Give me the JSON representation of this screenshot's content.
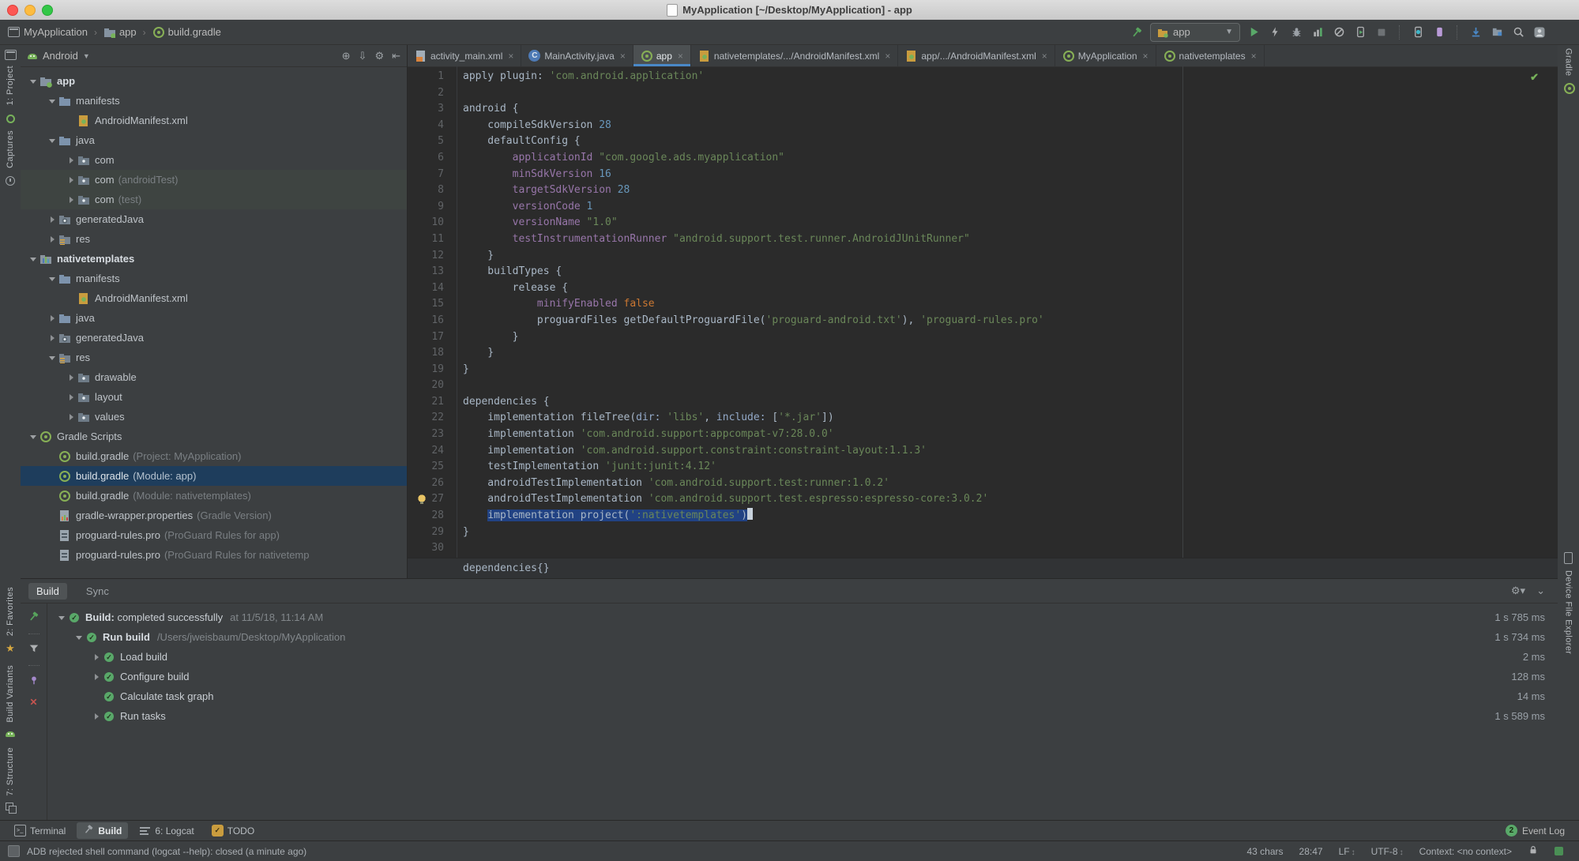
{
  "window": {
    "title": "MyApplication [~/Desktop/MyApplication] - app"
  },
  "navbar": {
    "breadcrumbs": [
      "MyApplication",
      "app",
      "build.gradle"
    ],
    "run_config": "app"
  },
  "left_strip": {
    "project": "1: Project",
    "captures": "Captures",
    "favorites": "2: Favorites",
    "build_variants": "Build Variants",
    "structure": "7: Structure"
  },
  "right_strip": {
    "gradle": "Gradle",
    "device_explorer": "Device File Explorer"
  },
  "project_panel": {
    "view_selector": "Android",
    "tree": [
      {
        "indent": 0,
        "arrow": "d",
        "icon": "folder-app",
        "label": "app",
        "bold": true
      },
      {
        "indent": 1,
        "arrow": "d",
        "icon": "folder-blue",
        "label": "manifests"
      },
      {
        "indent": 2,
        "arrow": "n",
        "icon": "manifest",
        "label": "AndroidManifest.xml"
      },
      {
        "indent": 1,
        "arrow": "d",
        "icon": "folder-blue",
        "label": "java"
      },
      {
        "indent": 2,
        "arrow": "r",
        "icon": "pkg",
        "label": "com"
      },
      {
        "indent": 2,
        "arrow": "r",
        "icon": "pkg",
        "label": "com",
        "suffix": "(androidTest)",
        "hl": true
      },
      {
        "indent": 2,
        "arrow": "r",
        "icon": "pkg",
        "label": "com",
        "suffix": "(test)",
        "hl": true
      },
      {
        "indent": 1,
        "arrow": "r",
        "icon": "folder-gen",
        "label": "generatedJava"
      },
      {
        "indent": 1,
        "arrow": "r",
        "icon": "folder-res",
        "label": "res"
      },
      {
        "indent": 0,
        "arrow": "d",
        "icon": "mod-native",
        "label": "nativetemplates",
        "bold": true
      },
      {
        "indent": 1,
        "arrow": "d",
        "icon": "folder-blue",
        "label": "manifests"
      },
      {
        "indent": 2,
        "arrow": "n",
        "icon": "manifest",
        "label": "AndroidManifest.xml"
      },
      {
        "indent": 1,
        "arrow": "r",
        "icon": "folder-blue",
        "label": "java"
      },
      {
        "indent": 1,
        "arrow": "r",
        "icon": "folder-gen",
        "label": "generatedJava"
      },
      {
        "indent": 1,
        "arrow": "d",
        "icon": "folder-res",
        "label": "res"
      },
      {
        "indent": 2,
        "arrow": "r",
        "icon": "pkg",
        "label": "drawable"
      },
      {
        "indent": 2,
        "arrow": "r",
        "icon": "pkg",
        "label": "layout"
      },
      {
        "indent": 2,
        "arrow": "r",
        "icon": "pkg",
        "label": "values"
      },
      {
        "indent": 0,
        "arrow": "d",
        "icon": "gradle",
        "label": "Gradle Scripts"
      },
      {
        "indent": 1,
        "arrow": "n",
        "icon": "gradle",
        "label": "build.gradle",
        "suffix": "(Project: MyApplication)"
      },
      {
        "indent": 1,
        "arrow": "n",
        "icon": "gradle",
        "label": "build.gradle",
        "suffix": "(Module: app)",
        "selected": true
      },
      {
        "indent": 1,
        "arrow": "n",
        "icon": "gradle",
        "label": "build.gradle",
        "suffix": "(Module: nativetemplates)"
      },
      {
        "indent": 1,
        "arrow": "n",
        "icon": "wrapper",
        "label": "gradle-wrapper.properties",
        "suffix": "(Gradle Version)"
      },
      {
        "indent": 1,
        "arrow": "n",
        "icon": "profile",
        "label": "proguard-rules.pro",
        "suffix": "(ProGuard Rules for app)"
      },
      {
        "indent": 1,
        "arrow": "n",
        "icon": "profile",
        "label": "proguard-rules.pro",
        "suffix": "(ProGuard Rules for nativetemp"
      }
    ]
  },
  "editor": {
    "tabs": [
      {
        "icon": "layoutfile",
        "label": "activity_main.xml"
      },
      {
        "icon": "classfile",
        "label": "MainActivity.java"
      },
      {
        "icon": "gradle",
        "label": "app",
        "active": true
      },
      {
        "icon": "manifest",
        "label": "nativetemplates/.../AndroidManifest.xml"
      },
      {
        "icon": "manifest",
        "label": "app/.../AndroidManifest.xml"
      },
      {
        "icon": "gradle",
        "label": "MyApplication"
      },
      {
        "icon": "gradle",
        "label": "nativetemplates"
      }
    ],
    "breadcrumb": "dependencies{}",
    "lines": [
      {
        "segs": [
          [
            "d",
            "apply plugin: "
          ],
          [
            "s",
            "'com.android.application'"
          ]
        ]
      },
      {
        "segs": []
      },
      {
        "segs": [
          [
            "d",
            "android {"
          ]
        ]
      },
      {
        "segs": [
          [
            "d",
            "    compileSdkVersion "
          ],
          [
            "n",
            "28"
          ]
        ]
      },
      {
        "segs": [
          [
            "d",
            "    defaultConfig {"
          ]
        ]
      },
      {
        "segs": [
          [
            "d",
            "        "
          ],
          [
            "p",
            "applicationId"
          ],
          [
            "d",
            " "
          ],
          [
            "s",
            "\"com.google.ads.myapplication\""
          ]
        ]
      },
      {
        "segs": [
          [
            "d",
            "        "
          ],
          [
            "p",
            "minSdkVersion"
          ],
          [
            "d",
            " "
          ],
          [
            "n",
            "16"
          ]
        ]
      },
      {
        "segs": [
          [
            "d",
            "        "
          ],
          [
            "p",
            "targetSdkVersion"
          ],
          [
            "d",
            " "
          ],
          [
            "n",
            "28"
          ]
        ]
      },
      {
        "segs": [
          [
            "d",
            "        "
          ],
          [
            "p",
            "versionCode"
          ],
          [
            "d",
            " "
          ],
          [
            "n",
            "1"
          ]
        ]
      },
      {
        "segs": [
          [
            "d",
            "        "
          ],
          [
            "p",
            "versionName"
          ],
          [
            "d",
            " "
          ],
          [
            "s",
            "\"1.0\""
          ]
        ]
      },
      {
        "segs": [
          [
            "d",
            "        "
          ],
          [
            "p",
            "testInstrumentationRunner"
          ],
          [
            "d",
            " "
          ],
          [
            "s",
            "\"android.support.test.runner.AndroidJUnitRunner\""
          ]
        ]
      },
      {
        "segs": [
          [
            "d",
            "    }"
          ]
        ]
      },
      {
        "segs": [
          [
            "d",
            "    buildTypes {"
          ]
        ]
      },
      {
        "segs": [
          [
            "d",
            "        release {"
          ]
        ]
      },
      {
        "segs": [
          [
            "d",
            "            "
          ],
          [
            "p",
            "minifyEnabled"
          ],
          [
            "d",
            " "
          ],
          [
            "k",
            "false"
          ]
        ]
      },
      {
        "segs": [
          [
            "d",
            "            proguardFiles getDefaultProguardFile("
          ],
          [
            "s",
            "'proguard-android.txt'"
          ],
          [
            "d",
            "), "
          ],
          [
            "s",
            "'proguard-rules.pro'"
          ]
        ]
      },
      {
        "segs": [
          [
            "d",
            "        }"
          ]
        ]
      },
      {
        "segs": [
          [
            "d",
            "    }"
          ]
        ]
      },
      {
        "segs": [
          [
            "d",
            "}"
          ]
        ]
      },
      {
        "segs": []
      },
      {
        "segs": [
          [
            "d",
            "dependencies {"
          ]
        ]
      },
      {
        "segs": [
          [
            "d",
            "    implementation fileTree("
          ],
          [
            "a",
            "dir:"
          ],
          [
            "d",
            " "
          ],
          [
            "s",
            "'libs'"
          ],
          [
            "d",
            ", "
          ],
          [
            "a",
            "include:"
          ],
          [
            "d",
            " ["
          ],
          [
            "s",
            "'*.jar'"
          ],
          [
            "d",
            "])"
          ]
        ]
      },
      {
        "segs": [
          [
            "d",
            "    implementation "
          ],
          [
            "s",
            "'com.android.support:appcompat-v7:28.0.0'"
          ]
        ]
      },
      {
        "segs": [
          [
            "d",
            "    implementation "
          ],
          [
            "s",
            "'com.android.support.constraint:constraint-layout:1.1.3'"
          ]
        ]
      },
      {
        "segs": [
          [
            "d",
            "    testImplementation "
          ],
          [
            "s",
            "'junit:junit:4.12'"
          ]
        ]
      },
      {
        "segs": [
          [
            "d",
            "    androidTestImplementation "
          ],
          [
            "s",
            "'com.android.support.test:runner:1.0.2'"
          ]
        ]
      },
      {
        "segs": [
          [
            "d",
            "    androidTestImplementation "
          ],
          [
            "s",
            "'com.android.support.test.espresso:espresso-core:3.0.2'"
          ]
        ],
        "bulb": true
      },
      {
        "pre": "    ",
        "sel": [
          [
            "d",
            "implementation project("
          ],
          [
            "s",
            "':nativetemplates'"
          ],
          [
            "d",
            ")"
          ]
        ],
        "caret": true
      },
      {
        "segs": [
          [
            "d",
            "}"
          ]
        ]
      },
      {
        "segs": []
      }
    ]
  },
  "build_panel": {
    "tabs": [
      "Build",
      "Sync"
    ],
    "rows": [
      {
        "indent": 0,
        "arrow": "d",
        "bold": "Build:",
        "text": " completed successfully",
        "meta": "at 11/5/18, 11:14 AM",
        "duration": "1 s 785 ms"
      },
      {
        "indent": 1,
        "arrow": "d",
        "bold": "Run build",
        "text": "",
        "meta": "/Users/jweisbaum/Desktop/MyApplication",
        "duration": "1 s 734 ms"
      },
      {
        "indent": 2,
        "arrow": "r",
        "bold": "",
        "text": "Load build",
        "meta": "",
        "duration": "2 ms"
      },
      {
        "indent": 2,
        "arrow": "r",
        "bold": "",
        "text": "Configure build",
        "meta": "",
        "duration": "128 ms"
      },
      {
        "indent": 2,
        "arrow": "n",
        "bold": "",
        "text": "Calculate task graph",
        "meta": "",
        "duration": "14 ms"
      },
      {
        "indent": 2,
        "arrow": "r",
        "bold": "",
        "text": "Run tasks",
        "meta": "",
        "duration": "1 s 589 ms"
      }
    ]
  },
  "bottom_bar": {
    "items": [
      {
        "icon": "terminal",
        "label": "Terminal"
      },
      {
        "icon": "hammer",
        "label": "Build",
        "active": true
      },
      {
        "icon": "logbars",
        "label": "6: Logcat"
      },
      {
        "icon": "todo",
        "label": "TODO"
      }
    ],
    "event_log": {
      "badge": "2",
      "label": "Event Log"
    }
  },
  "status_bar": {
    "message": "ADB rejected shell command (logcat --help): closed (a minute ago)",
    "chars": "43 chars",
    "position": "28:47",
    "line_separator": "LF",
    "encoding": "UTF-8",
    "context": "Context: <no context>"
  }
}
